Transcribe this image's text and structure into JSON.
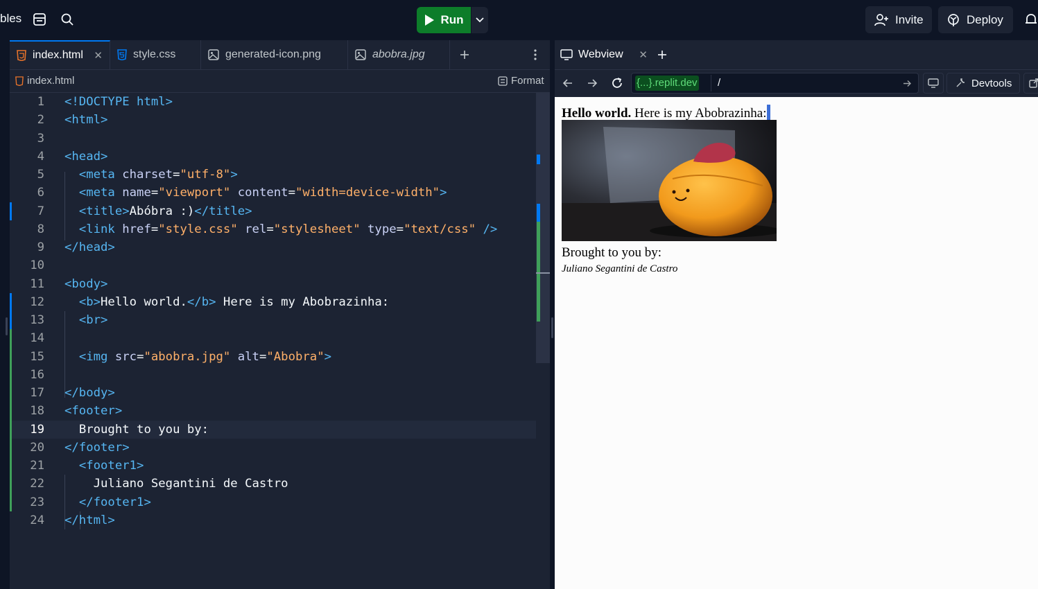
{
  "topbar": {
    "left_text": "bles",
    "run_label": "Run",
    "invite_label": "Invite",
    "deploy_label": "Deploy"
  },
  "editor": {
    "tabs": [
      {
        "label": "index.html",
        "icon": "html5-icon"
      },
      {
        "label": "style.css",
        "icon": "css3-icon"
      },
      {
        "label": "generated-icon.png",
        "icon": "image-icon"
      },
      {
        "label": "abobra.jpg",
        "icon": "image-icon"
      }
    ],
    "breadcrumb": "index.html",
    "format_label": "Format",
    "current_line": 19
  },
  "webview": {
    "tab_label": "Webview",
    "url_host": "{...}.replit.dev",
    "url_path": "/",
    "devtools_label": "Devtools",
    "page": {
      "bold_text": "Hello world.",
      "text": " Here is my Abobrazinha:",
      "img_alt": "Abobra",
      "footer_text": "Brought to you by:",
      "footer1_text": "Juliano Segantini de Castro"
    }
  },
  "colors": {
    "run_green": "#0d7d2a",
    "tag_blue": "#56b6f2",
    "string_orange": "#ffb069",
    "gutter_green": "#3fa05a",
    "gutter_blue": "#0079f2"
  }
}
